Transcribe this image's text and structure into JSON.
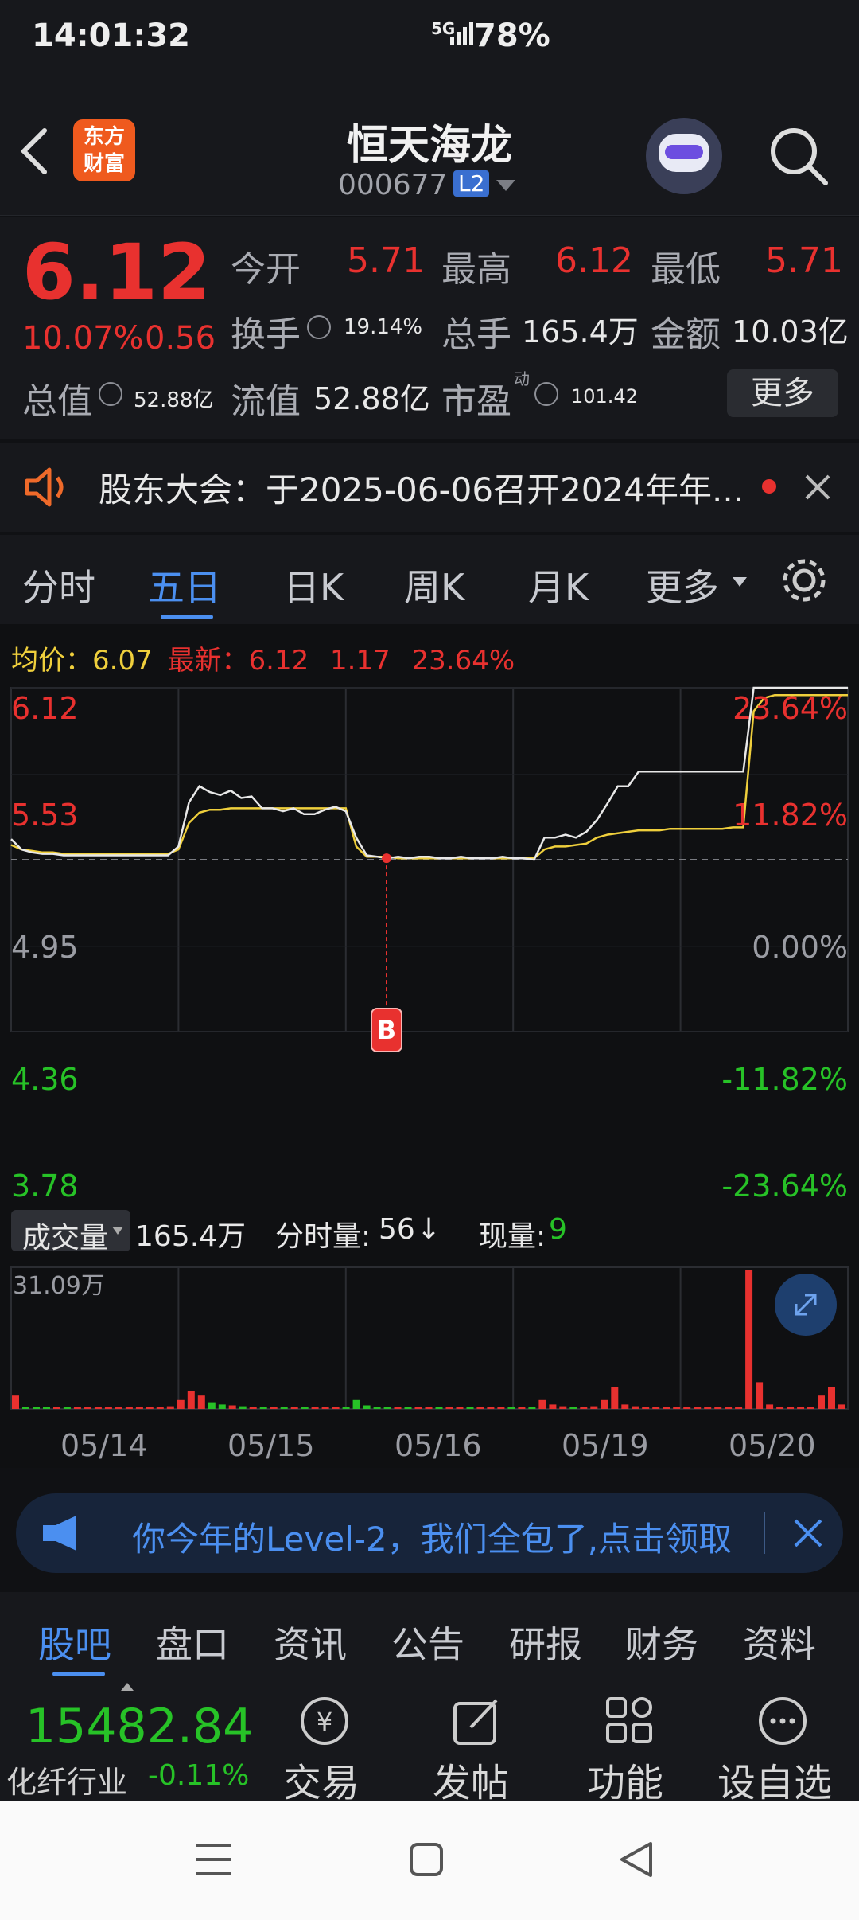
{
  "status_bar": {
    "time": "14:01:32",
    "network": "5G",
    "battery": "78%"
  },
  "header": {
    "title": "恒天海龙",
    "code": "000677",
    "level_badge": "L2",
    "logo_line1": "东方",
    "logo_line2": "财富"
  },
  "quote": {
    "price": "6.12",
    "change_pct": "10.07%",
    "change": "0.56",
    "open_label": "今开",
    "open": "5.71",
    "high_label": "最高",
    "high": "6.12",
    "low_label": "最低",
    "low": "5.71",
    "turnover_label": "换手",
    "turnover": "19.14%",
    "volume_label": "总手",
    "volume": "165.4万",
    "amount_label": "金额",
    "amount": "10.03亿",
    "mktcap_label": "总值",
    "mktcap": "52.88亿",
    "float_label": "流值",
    "float": "52.88亿",
    "pe_label": "市盈",
    "pe_sup": "动",
    "pe": "101.42",
    "more_button": "更多"
  },
  "notice": {
    "text": "股东大会：于2025-06-06召开2024年年..."
  },
  "chart_tabs": [
    "分时",
    "五日",
    "日K",
    "周K",
    "月K",
    "更多"
  ],
  "chart_info": {
    "avg_label": "均价：",
    "avg": "6.07",
    "latest_label": "最新：",
    "latest": "6.12",
    "change": "1.17",
    "change_pct": "23.64%"
  },
  "volume_bar": {
    "selector": "成交量",
    "total": "165.4万",
    "tick_vol_label": "分时量:",
    "tick_vol": "56",
    "tick_arrow": "↓",
    "now_label": "现量:",
    "now": "9",
    "max_label": "31.09万"
  },
  "trade_marker": "B",
  "chart_data": {
    "type": "line",
    "title": "",
    "x_labels": [
      "05/14",
      "05/15",
      "05/16",
      "05/19",
      "05/20"
    ],
    "y_left_ticks": [
      "6.12",
      "5.53",
      "4.95",
      "4.36",
      "3.78"
    ],
    "y_right_ticks": [
      "23.64%",
      "11.82%",
      "0.00%",
      "-11.82%",
      "-23.64%"
    ],
    "ylim": [
      3.78,
      6.12
    ],
    "reference_price": 4.95,
    "grid": true,
    "series": [
      {
        "name": "最新",
        "color": "#e8e8e8",
        "values": [
          5.09,
          5.02,
          5.0,
          4.99,
          4.99,
          4.98,
          4.98,
          4.98,
          4.98,
          4.98,
          4.98,
          4.98,
          4.98,
          4.98,
          4.98,
          4.98,
          5.04,
          5.34,
          5.45,
          5.41,
          5.39,
          5.42,
          5.37,
          5.38,
          5.3,
          5.3,
          5.28,
          5.3,
          5.26,
          5.26,
          5.29,
          5.31,
          5.28,
          5.1,
          4.98,
          4.97,
          4.96,
          4.97,
          4.96,
          4.97,
          4.97,
          4.96,
          4.96,
          4.97,
          4.96,
          4.96,
          4.96,
          4.97,
          4.96,
          4.96,
          4.95,
          5.1,
          5.1,
          5.12,
          5.1,
          5.14,
          5.22,
          5.33,
          5.45,
          5.45,
          5.55,
          5.55,
          5.55,
          5.55,
          5.55,
          5.55,
          5.55,
          5.55,
          5.55,
          5.55,
          5.55,
          6.12,
          6.12,
          6.12,
          6.12,
          6.12,
          6.12,
          6.12,
          6.12,
          6.12,
          6.12
        ]
      },
      {
        "name": "均价",
        "color": "#efcf3c",
        "values": [
          5.05,
          5.02,
          5.01,
          5.0,
          5.0,
          4.99,
          4.99,
          4.99,
          4.99,
          4.99,
          4.99,
          4.99,
          4.99,
          4.99,
          4.99,
          4.99,
          5.02,
          5.2,
          5.27,
          5.29,
          5.29,
          5.3,
          5.3,
          5.3,
          5.3,
          5.3,
          5.3,
          5.3,
          5.3,
          5.3,
          5.3,
          5.3,
          5.3,
          5.04,
          4.97,
          4.97,
          4.97,
          4.96,
          4.96,
          4.96,
          4.96,
          4.96,
          4.96,
          4.96,
          4.96,
          4.96,
          4.96,
          4.96,
          4.96,
          4.96,
          4.96,
          5.02,
          5.04,
          5.04,
          5.05,
          5.06,
          5.1,
          5.12,
          5.13,
          5.14,
          5.15,
          5.15,
          5.15,
          5.16,
          5.16,
          5.16,
          5.16,
          5.16,
          5.16,
          5.17,
          5.17,
          5.96,
          6.05,
          6.07,
          6.07,
          6.07,
          6.07,
          6.07,
          6.07,
          6.07,
          6.07
        ]
      }
    ],
    "volume": {
      "max": "31.09万",
      "values": [
        3,
        0.5,
        0.4,
        0.3,
        0.3,
        0.2,
        0.3,
        0.2,
        0.2,
        0.3,
        0.2,
        0.2,
        0.3,
        0.2,
        0.3,
        0.6,
        2,
        4,
        3,
        1.5,
        1,
        0.8,
        0.6,
        0.5,
        0.5,
        0.4,
        0.4,
        0.5,
        0.4,
        0.5,
        0.5,
        0.4,
        0.5,
        2,
        0.8,
        0.5,
        0.4,
        0.3,
        0.3,
        0.3,
        0.3,
        0.3,
        0.3,
        0.3,
        0.2,
        0.3,
        0.3,
        0.3,
        0.4,
        0.4,
        0.5,
        2,
        1,
        0.6,
        0.5,
        0.4,
        0.6,
        2,
        5,
        1,
        0.6,
        0.5,
        0.4,
        0.4,
        0.3,
        0.3,
        0.3,
        0.3,
        0.3,
        0.4,
        0.5,
        31.09,
        6,
        1,
        0.5,
        0.4,
        0.4,
        0.4,
        3,
        5,
        1
      ]
    }
  },
  "banner": {
    "text": "你今年的Level-2，我们全包了,点击领取"
  },
  "bottom_tabs": [
    "股吧",
    "盘口",
    "资讯",
    "公告",
    "研报",
    "财务",
    "资料"
  ],
  "toolbar": {
    "index_value": "15482.84",
    "index_name": "化纤行业",
    "index_change": "-0.11%",
    "buttons": [
      "交易",
      "发帖",
      "功能",
      "设自选"
    ]
  }
}
